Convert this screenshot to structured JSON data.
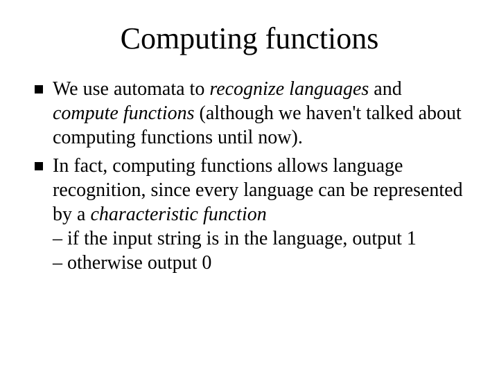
{
  "slide": {
    "title": "Computing functions",
    "bullets": [
      {
        "pre1": "We use automata to ",
        "em1": "recognize languages",
        "mid1": " and ",
        "em2": "compute functions",
        "post1": " (although we haven't talked about computing functions until now)."
      },
      {
        "pre1": " In fact, computing functions allows language recognition, since every language can be represented by a ",
        "em1": "characteristic function",
        "sub1": "– if the input string is in the language, output 1",
        "sub2": "– otherwise output 0"
      }
    ]
  }
}
